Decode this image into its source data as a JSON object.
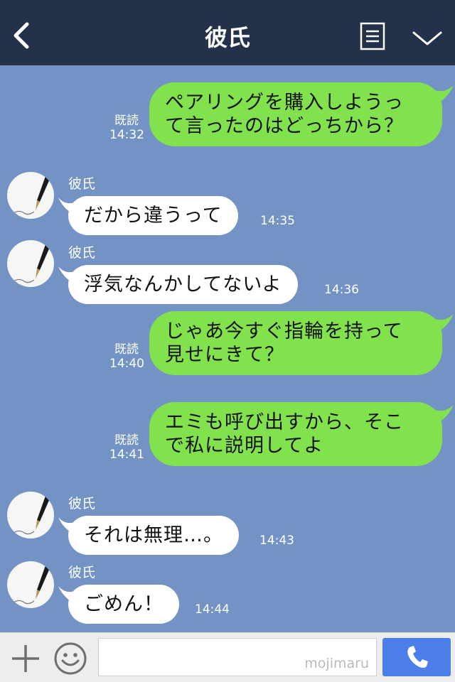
{
  "header": {
    "title": "彼氏"
  },
  "messages": [
    {
      "side": "me",
      "text": "ペアリングを購入しようっ\nて言ったのはどっちから？",
      "read_label": "既読",
      "time": "14:32"
    },
    {
      "side": "them",
      "sender": "彼氏",
      "text": "だから違うって",
      "time": "14:35"
    },
    {
      "side": "them",
      "sender": "彼氏",
      "text": "浮気なんかしてないよ",
      "time": "14:36"
    },
    {
      "side": "me",
      "text": "じゃあ今すぐ指輪を持って\n見せにきて？",
      "read_label": "既読",
      "time": "14:40"
    },
    {
      "side": "me",
      "text": "エミも呼び出すから、そこ\nで私に説明してよ",
      "read_label": "既読",
      "time": "14:41"
    },
    {
      "side": "them",
      "sender": "彼氏",
      "text": "それは無理…。",
      "time": "14:43"
    },
    {
      "side": "them",
      "sender": "彼氏",
      "text": "ごめん！",
      "time": "14:44"
    }
  ],
  "footer": {
    "input_value": "",
    "watermark": "mojimaru"
  },
  "icons": {
    "back": "chevron-left-icon",
    "menu": "notes-icon",
    "expand": "chevron-down-icon",
    "add": "plus-icon",
    "sticker": "smiley-icon",
    "call": "phone-icon"
  },
  "colors": {
    "header_bg": "#24314a",
    "chat_bg": "#7393c4",
    "my_bubble": "#82e24e",
    "their_bubble": "#ffffff",
    "send_button": "#4b7ee8"
  }
}
